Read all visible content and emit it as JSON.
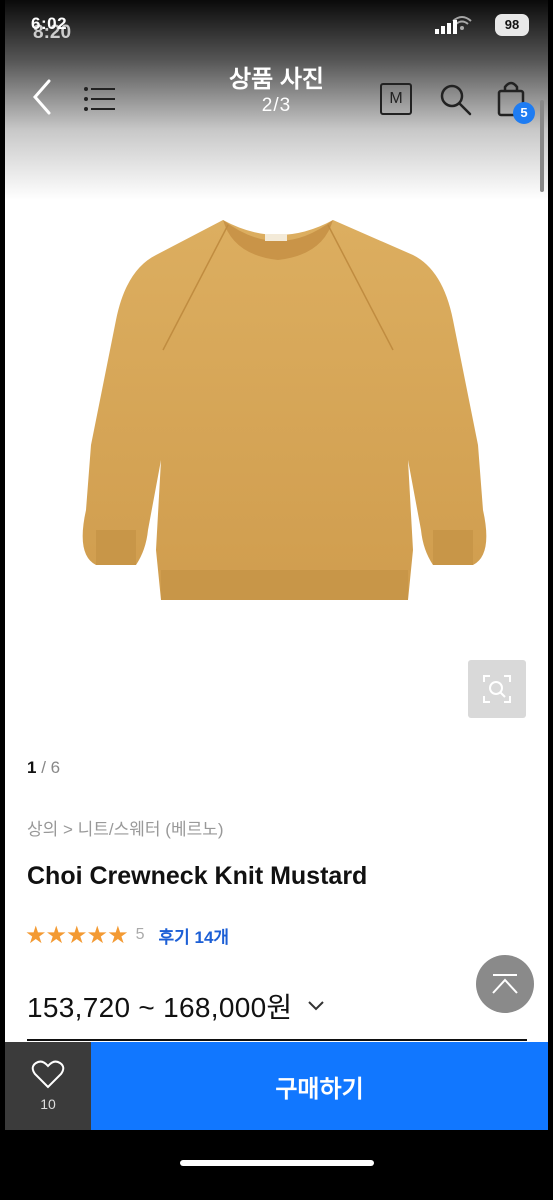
{
  "status_bar": {
    "time": "6:02",
    "time_behind": "8:20",
    "battery": "98"
  },
  "header": {
    "title": "상품 사진",
    "subtitle": "2/3",
    "m_label": "M",
    "cart_count": "5"
  },
  "gallery": {
    "current": "1",
    "total": "/ 6"
  },
  "product": {
    "breadcrumb": "상의 > 니트/스웨터 (베르노)",
    "name": "Choi Crewneck Knit Mustard",
    "stars": "★★★★★",
    "rating": "5",
    "reviews": "후기 14개",
    "price": "153,720 ~ 168,000원"
  },
  "bottom_bar": {
    "like_count": "10",
    "buy_label": "구매하기"
  },
  "colors": {
    "accent": "#1177ff",
    "star": "#f39a33",
    "sweater": "#d9a858",
    "like_bg": "#3b3b3b"
  }
}
